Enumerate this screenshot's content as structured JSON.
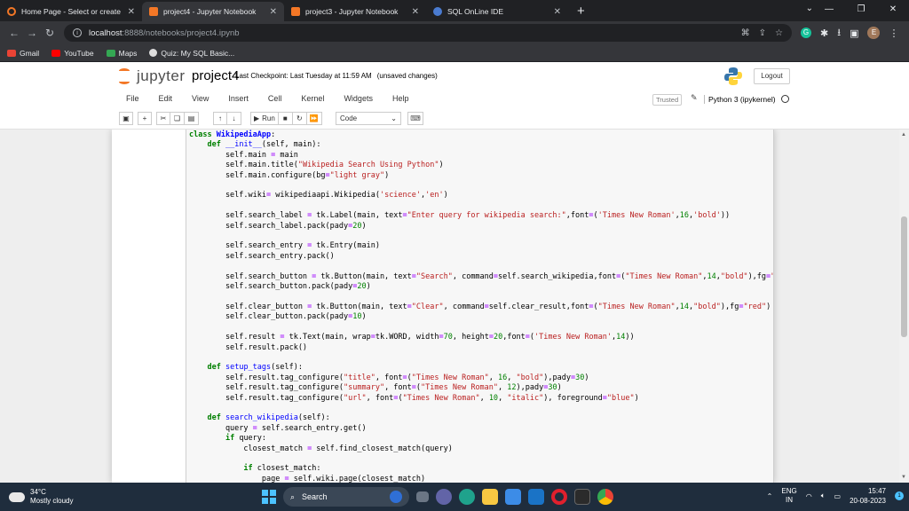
{
  "browser": {
    "tabs": [
      {
        "title": "Home Page - Select or create a n",
        "favicon_color": "#f37726"
      },
      {
        "title": "project4 - Jupyter Notebook",
        "favicon_color": "#f37726"
      },
      {
        "title": "project3 - Jupyter Notebook",
        "favicon_color": "#f37726"
      },
      {
        "title": "SQL OnLine IDE",
        "favicon_color": "#4a7bd0"
      }
    ],
    "url_host": "localhost",
    "url_path": ":8888/notebooks/project4.ipynb",
    "profile_initial": "E",
    "bookmarks": [
      {
        "label": "Gmail",
        "color": "#ea4335"
      },
      {
        "label": "YouTube",
        "color": "#ff0000"
      },
      {
        "label": "Maps",
        "color": "#34a853"
      },
      {
        "label": "Quiz: My SQL Basic...",
        "color": "#dddddd"
      }
    ]
  },
  "jupyter": {
    "logo_text": "jupyter",
    "notebook_name": "project4",
    "checkpoint": "Last Checkpoint: Last Tuesday at 11:59 AM",
    "save_status": "(unsaved changes)",
    "logout_label": "Logout",
    "menus": [
      "File",
      "Edit",
      "View",
      "Insert",
      "Cell",
      "Kernel",
      "Widgets",
      "Help"
    ],
    "trusted_label": "Trusted",
    "kernel_name": "Python 3 (ipykernel)",
    "run_label": "Run",
    "cell_type": "Code"
  },
  "taskbar": {
    "temperature": "34°C",
    "weather": "Mostly cloudy",
    "search_label": "Search",
    "lang_line1": "ENG",
    "lang_line2": "IN",
    "time": "15:47",
    "date": "20-08-2023",
    "notification_count": "1"
  },
  "colors": {
    "jupyter_orange": "#f37726",
    "keyword_green": "#008000",
    "string_red": "#ba2121",
    "def_blue": "#0000ff"
  }
}
